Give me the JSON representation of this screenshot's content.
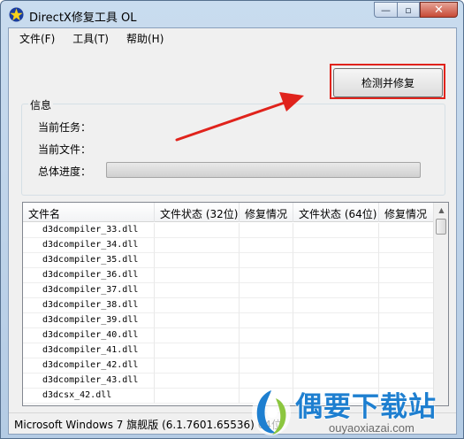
{
  "window": {
    "title": "DirectX修复工具 OL"
  },
  "caption": {
    "minimize": "—",
    "maximize": "▫",
    "close": "✕"
  },
  "menu": {
    "items": [
      "文件(F)",
      "工具(T)",
      "帮助(H)"
    ]
  },
  "action_button": "检测并修复",
  "info": {
    "group_title": "信息",
    "current_task_label": "当前任务：",
    "current_file_label": "当前文件：",
    "progress_label": "总体进度：",
    "progress": 0
  },
  "table": {
    "columns": [
      "文件名",
      "文件状态 (32位)",
      "修复情况",
      "文件状态 (64位)",
      "修复情况"
    ],
    "rows": [
      "d3dcompiler_33.dll",
      "d3dcompiler_34.dll",
      "d3dcompiler_35.dll",
      "d3dcompiler_36.dll",
      "d3dcompiler_37.dll",
      "d3dcompiler_38.dll",
      "d3dcompiler_39.dll",
      "d3dcompiler_40.dll",
      "d3dcompiler_41.dll",
      "d3dcompiler_42.dll",
      "d3dcompiler_43.dll",
      "d3dcsx_42.dll"
    ]
  },
  "status_text": "Microsoft Windows 7 旗舰版 (6.1.7601.65536) 64位",
  "watermark": {
    "name": "偶要下载站",
    "url": "ouyaoxiazai.com"
  },
  "colors": {
    "highlight": "#e0231c",
    "watermark": "#1e7fd0"
  }
}
